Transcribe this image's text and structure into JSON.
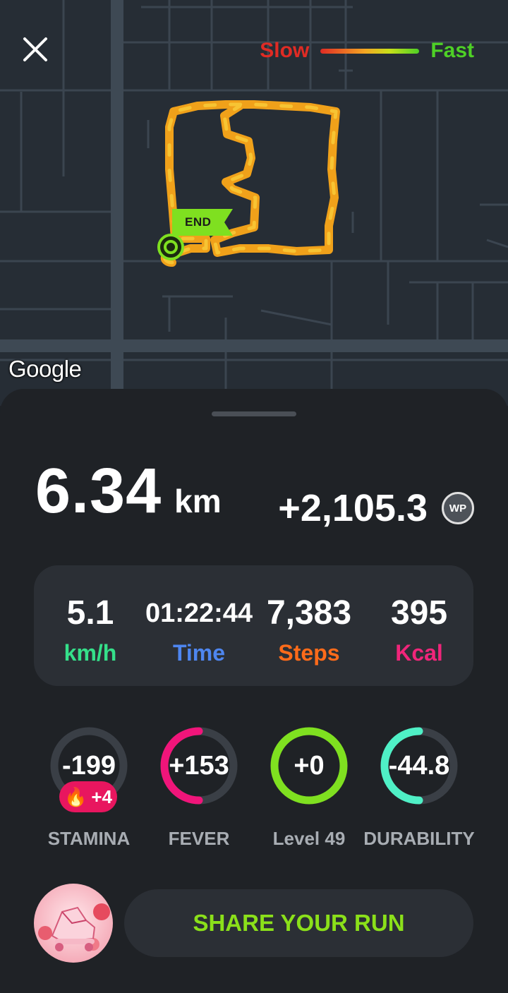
{
  "map": {
    "legend": {
      "slow_label": "Slow",
      "fast_label": "Fast"
    },
    "end_label": "END",
    "attribution": "Google"
  },
  "summary": {
    "distance_value": "6.34",
    "distance_unit": "km",
    "points_value": "+2,105.3",
    "points_badge": "WP"
  },
  "stats": [
    {
      "value": "5.1",
      "label": "km/h",
      "color": "#35e08a"
    },
    {
      "value": "01:22:44",
      "label": "Time",
      "color": "#4e86f0"
    },
    {
      "value": "7,383",
      "label": "Steps",
      "color": "#ff6b1a"
    },
    {
      "value": "395",
      "label": "Kcal",
      "color": "#f0257a"
    }
  ],
  "attributes": [
    {
      "value": "-199",
      "label": "STAMINA",
      "color": "#3a3f46",
      "fill": 0.0,
      "badge": "+4"
    },
    {
      "value": "+153",
      "label": "FEVER",
      "color": "#f0157a",
      "fill": 0.5
    },
    {
      "value": "+0",
      "label": "Level 49",
      "color": "#7fe020",
      "fill": 1.0
    },
    {
      "value": "-44.8",
      "label": "DURABILITY",
      "color": "#4ff0c6",
      "fill": 0.5
    }
  ],
  "share_label": "SHARE YOUR RUN",
  "colors": {
    "background": "#1f2226",
    "card": "#2b2f35",
    "map": "#262d35"
  }
}
